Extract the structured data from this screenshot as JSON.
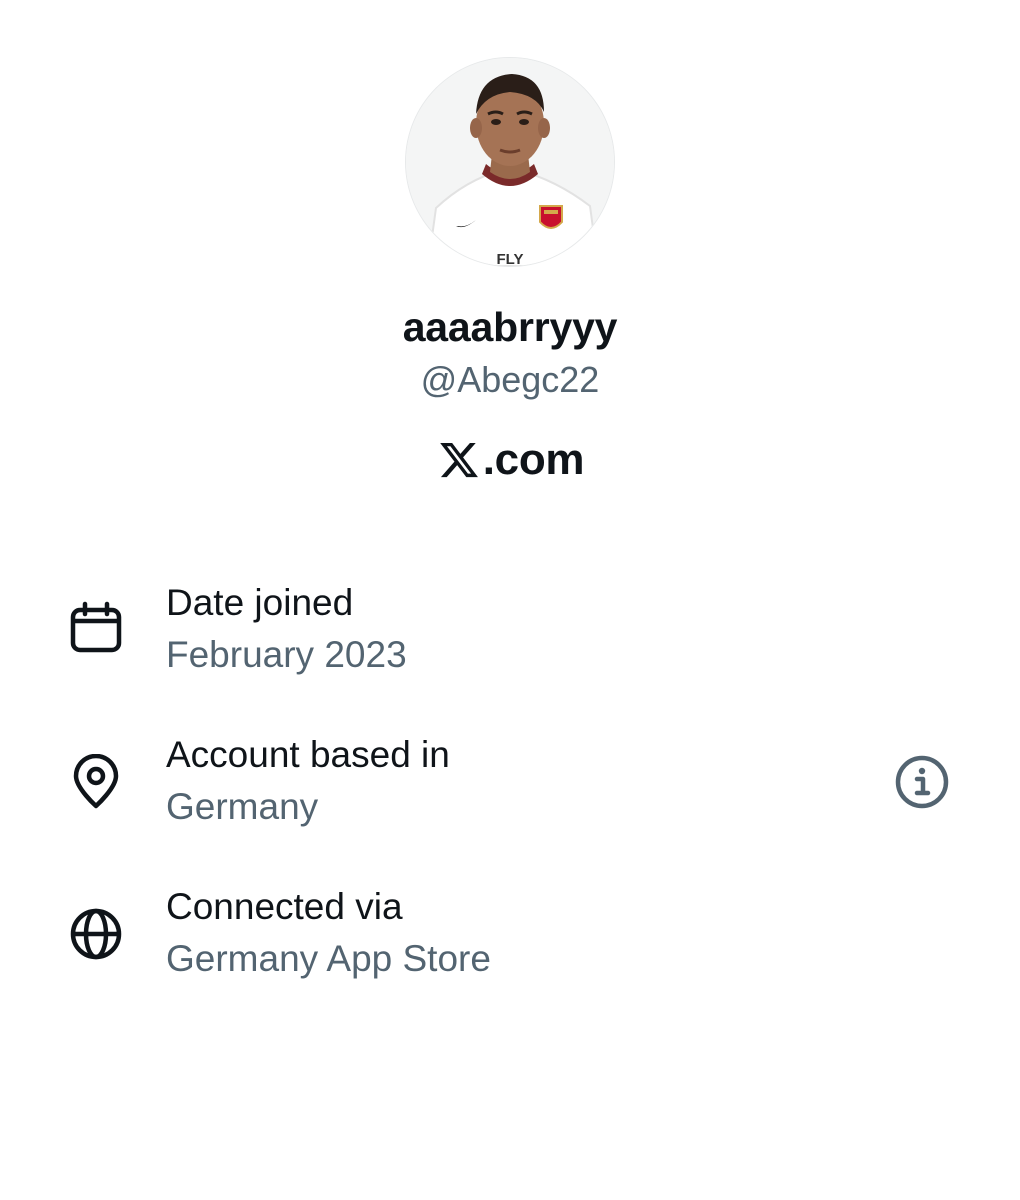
{
  "profile": {
    "display_name": "aaaabrryyy",
    "handle": "@Abegc22",
    "site": ".com",
    "site_logo_icon": "x-logo-icon",
    "avatar_shirt_text": "FLY"
  },
  "about": {
    "rows": [
      {
        "icon": "calendar-icon",
        "label": "Date joined",
        "value": "February 2023"
      },
      {
        "icon": "location-pin-icon",
        "label": "Account based in",
        "value": "Germany",
        "action_icon": "info-icon"
      },
      {
        "icon": "globe-icon",
        "label": "Connected via",
        "value": "Germany App Store"
      }
    ]
  },
  "colors": {
    "primary_text": "#0f1419",
    "secondary_text": "#536471",
    "background": "#ffffff"
  }
}
